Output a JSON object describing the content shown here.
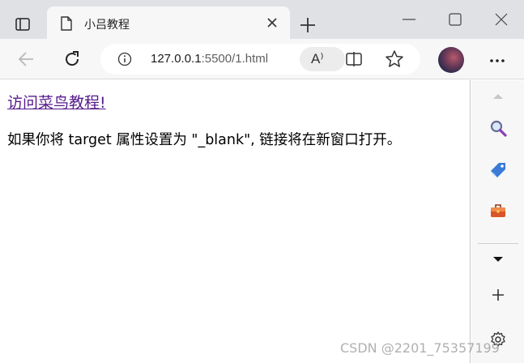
{
  "browser": {
    "tab": {
      "title": "小吕教程"
    },
    "address_bar": {
      "url_host": "127.0.0.1",
      "url_rest": ":5500/1.html"
    },
    "read_aloud_label": "A⁾"
  },
  "page": {
    "link_text": "访问菜鸟教程!",
    "paragraph": "如果你将 target 属性设置为 \"_blank\", 链接将在新窗口打开。"
  },
  "watermark": "CSDN @2201_75357199",
  "icons": {
    "tab_actions": "tab-actions-icon",
    "tab_page": "page-icon",
    "tab_close": "close-icon",
    "new_tab": "plus-icon",
    "minimize": "minimize-icon",
    "maximize": "maximize-icon",
    "window_close": "close-icon",
    "back": "back-arrow-icon",
    "reload": "reload-icon",
    "info": "info-icon",
    "read_aloud": "read-aloud-icon",
    "split_screen": "split-screen-icon",
    "favorites": "star-icon",
    "more": "more-icon",
    "sidebar_search": "search-icon",
    "sidebar_shopping": "tag-icon",
    "sidebar_tools": "toolbox-icon"
  },
  "colors": {
    "titlebar": "#dfe1e5",
    "toolbar": "#f7f7f7",
    "visited_link": "#551a8b"
  }
}
